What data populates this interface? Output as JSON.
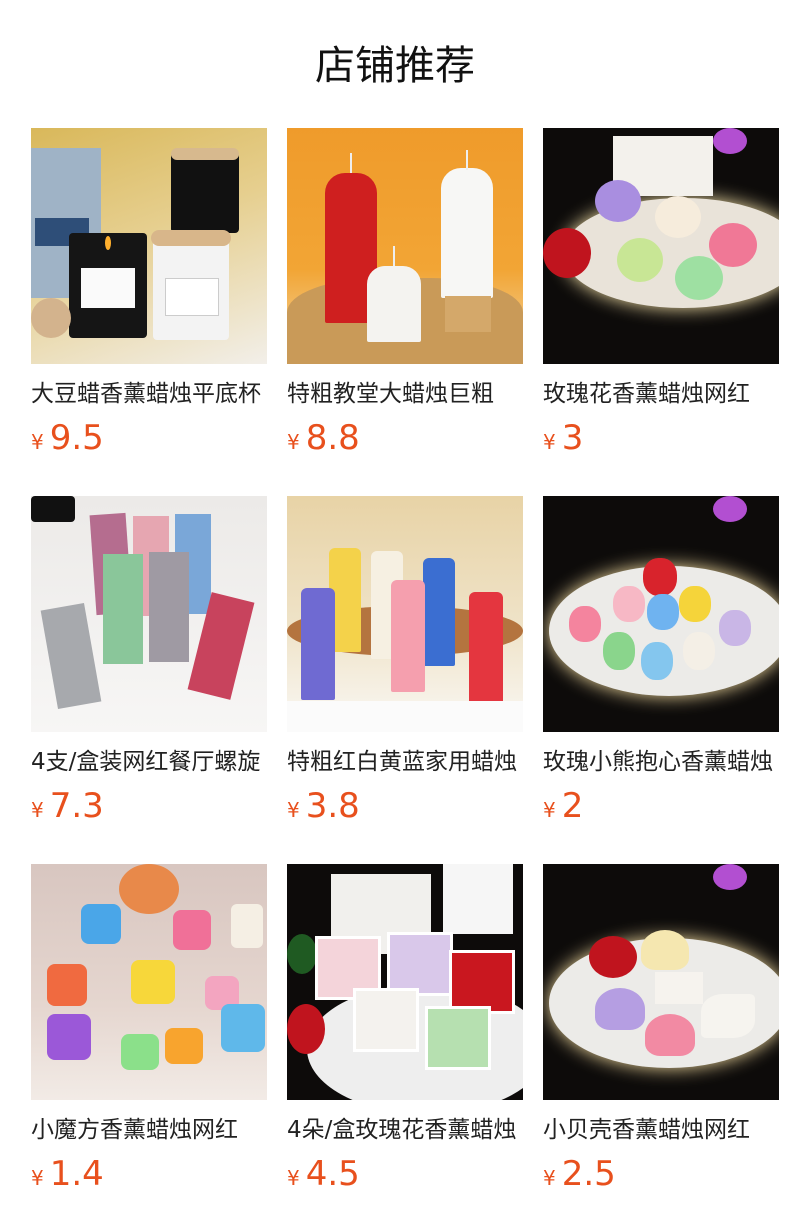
{
  "page_title": "店铺推荐",
  "currency_symbol": "¥",
  "accent_color": "#e8501d",
  "products": [
    {
      "name": "大豆蜡香薰蜡烛平底杯",
      "price": "9.5"
    },
    {
      "name": "特粗教堂大蜡烛巨粗",
      "price": "8.8"
    },
    {
      "name": "玫瑰花香薰蜡烛网红",
      "price": "3"
    },
    {
      "name": "4支/盒装网红餐厅螺旋",
      "price": "7.3"
    },
    {
      "name": "特粗红白黄蓝家用蜡烛",
      "price": "3.8"
    },
    {
      "name": "玫瑰小熊抱心香薰蜡烛",
      "price": "2"
    },
    {
      "name": "小魔方香薰蜡烛网红",
      "price": "1.4"
    },
    {
      "name": "4朵/盒玫瑰花香薰蜡烛",
      "price": "4.5"
    },
    {
      "name": "小贝壳香薰蜡烛网红",
      "price": "2.5"
    }
  ]
}
